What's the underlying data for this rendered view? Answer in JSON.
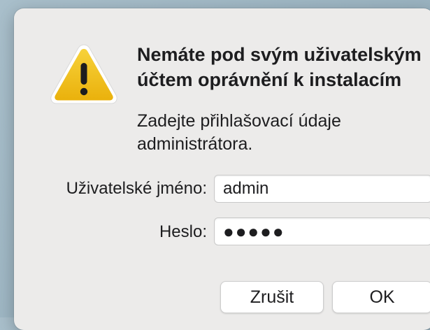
{
  "dialog": {
    "title": "Nemáte pod svým uživatelským účtem oprávnění k instalacím",
    "message": "Zadejte přihlašovací údaje administrátora.",
    "icon": "warning-icon",
    "colors": {
      "icon_fill": "#f2c21b",
      "icon_border": "#ffffff",
      "background": "#ecebea"
    }
  },
  "form": {
    "username_label": "Uživatelské jméno:",
    "username_value": "admin",
    "password_label": "Heslo:",
    "password_value": "●●●●●"
  },
  "buttons": {
    "cancel_label": "Zrušit",
    "ok_label": "OK"
  }
}
